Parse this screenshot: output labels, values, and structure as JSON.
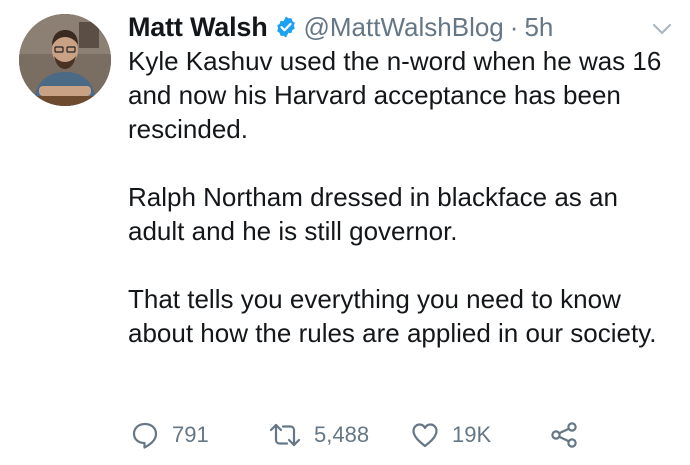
{
  "author": {
    "name": "Matt Walsh",
    "handle": "@MattWalshBlog",
    "separator": "·",
    "time": "5h",
    "verified": true
  },
  "tweet": {
    "paragraphs": [
      "Kyle Kashuv used the n-word when he was 16 and now his Harvard acceptance has been rescinded.",
      "Ralph Northam dressed in blackface as an adult and he is still governor.",
      "That tells you everything you need to know about how the rules are applied in our society."
    ]
  },
  "actions": {
    "replies": "791",
    "retweets": "5,488",
    "likes": "19K"
  },
  "icons": {
    "reply": "reply-icon",
    "retweet": "retweet-icon",
    "like": "heart-icon",
    "share": "share-icon",
    "menu": "chevron-down-icon",
    "verified": "verified-badge-icon"
  },
  "colors": {
    "text": "#14171a",
    "secondary": "#657786",
    "verified": "#1da1f2"
  }
}
